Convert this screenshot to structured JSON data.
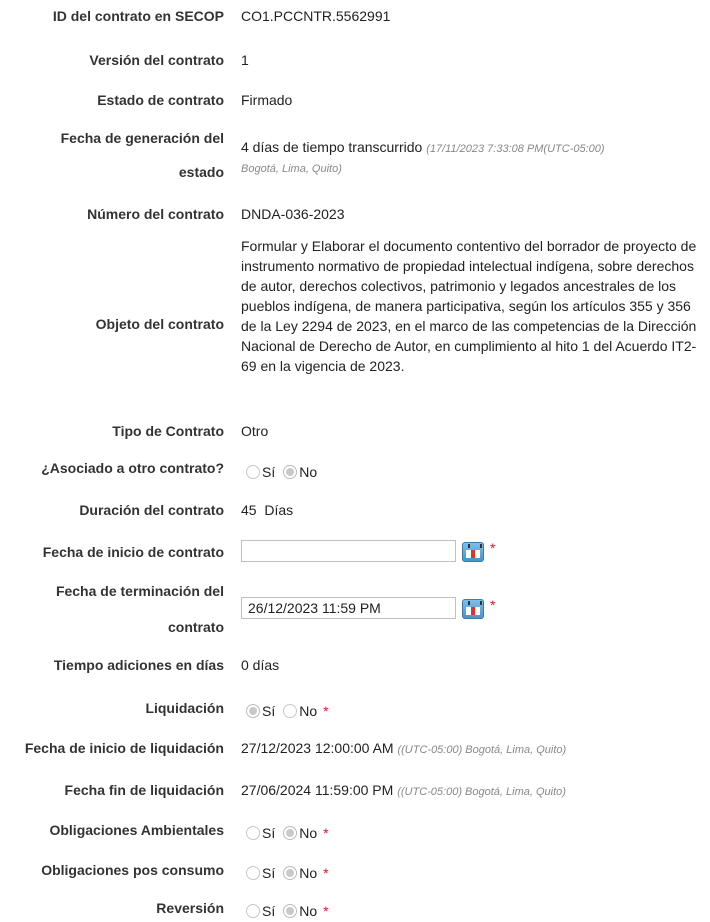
{
  "fields": {
    "secop_id": {
      "label": "ID del contrato en SECOP",
      "value": "CO1.PCCNTR.5562991"
    },
    "version": {
      "label": "Versión del contrato",
      "value": "1"
    },
    "estado": {
      "label": "Estado de contrato",
      "value": "Firmado"
    },
    "fecha_generacion": {
      "label_line1": "Fecha de generación del",
      "label_line2": "estado",
      "value": "4 días de tiempo transcurrido",
      "note_line1": "(17/11/2023 7:33:08 PM(UTC-05:00)",
      "note_line2": "Bogotá, Lima, Quito)"
    },
    "numero": {
      "label": "Número del contrato",
      "value": "DNDA-036-2023"
    },
    "objeto": {
      "label": "Objeto del contrato",
      "value": "Formular y Elaborar el documento contentivo del borrador de proyecto de instrumento normativo de propiedad intelectual indígena, sobre derechos de autor, derechos colectivos, patrimonio y legados ancestrales de los pueblos indígena, de manera participativa, según los artículos 355 y 356 de la Ley 2294 de 2023, en el marco de las competencias de la Dirección Nacional de Derecho de Autor, en cumplimiento al hito 1 del Acuerdo IT2-69 en la vigencia de 2023."
    },
    "tipo": {
      "label": "Tipo de Contrato",
      "value": "Otro"
    },
    "asociado": {
      "label": "¿Asociado a otro contrato?",
      "yes": "Sí",
      "no": "No",
      "selected": "No"
    },
    "duracion": {
      "label": "Duración del contrato",
      "value": "45  Días"
    },
    "fecha_inicio": {
      "label": "Fecha de inicio de contrato",
      "value": "",
      "required": "*"
    },
    "fecha_terminacion": {
      "label_line1": "Fecha de terminación del",
      "label_line2": "contrato",
      "value": "26/12/2023 11:59 PM",
      "required": "*"
    },
    "tiempo_adiciones": {
      "label": "Tiempo adiciones en días",
      "value": "0 días"
    },
    "liquidacion": {
      "label": "Liquidación",
      "yes": "Sí",
      "no": "No",
      "selected": "Sí",
      "required": "*"
    },
    "fecha_inicio_liq": {
      "label": "Fecha de inicio de liquidación",
      "value": "27/12/2023 12:00:00 AM",
      "note": "((UTC-05:00) Bogotá, Lima, Quito)"
    },
    "fecha_fin_liq": {
      "label": "Fecha fin de liquidación",
      "value": "27/06/2024 11:59:00 PM",
      "note": "((UTC-05:00) Bogotá, Lima, Quito)"
    },
    "oblig_amb": {
      "label": "Obligaciones Ambientales",
      "yes": "Sí",
      "no": "No",
      "selected": "No",
      "required": "*"
    },
    "oblig_pos": {
      "label": "Obligaciones pos consumo",
      "yes": "Sí",
      "no": "No",
      "selected": "No",
      "required": "*"
    },
    "reversion": {
      "label": "Reversión",
      "yes": "Sí",
      "no": "No",
      "selected": "No",
      "required": "*"
    }
  },
  "icons": {
    "calendar": "calendar-icon",
    "radio": "radio-button"
  },
  "colors": {
    "required": "#e0102a",
    "note": "#888888"
  }
}
